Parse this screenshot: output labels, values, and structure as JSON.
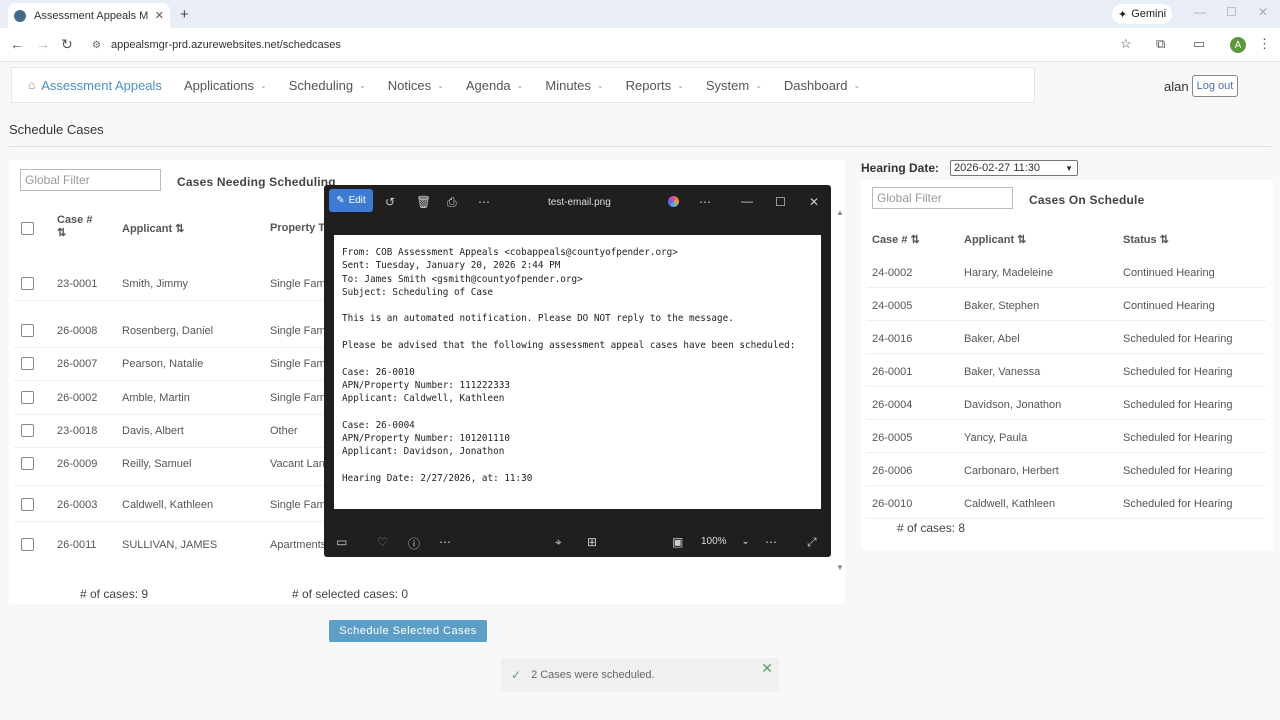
{
  "browser": {
    "tab_title": "Assessment Appeals Managem",
    "new_tab": "+",
    "gemini_label": "Gemini",
    "url": "appealsmgr-prd.azurewebsites.net/schedcases",
    "avatar_letter": "A"
  },
  "nav": {
    "brand": "Assessment Appeals",
    "menus": [
      "Applications",
      "Scheduling",
      "Notices",
      "Agenda",
      "Minutes",
      "Reports",
      "System",
      "Dashboard"
    ],
    "user": "alan",
    "logout": "Log out"
  },
  "page_title": "Schedule Cases",
  "left": {
    "filter_placeholder": "Global Filter",
    "title": "Cases Needing Scheduling",
    "columns": [
      "Case #",
      "Applicant",
      "Property T"
    ],
    "rows": [
      {
        "case": "23-0001",
        "applicant": "Smith, Jimmy",
        "property": "Single Fam"
      },
      {
        "case": "26-0008",
        "applicant": "Rosenberg, Daniel",
        "property": "Single Fam"
      },
      {
        "case": "26-0007",
        "applicant": "Pearson, Natalie",
        "property": "Single Fam"
      },
      {
        "case": "26-0002",
        "applicant": "Amble, Martin",
        "property": "Single Fam"
      },
      {
        "case": "23-0018",
        "applicant": "Davis, Albert",
        "property": "Other"
      },
      {
        "case": "26-0009",
        "applicant": "Reilly, Samuel",
        "property": "Vacant Lan"
      },
      {
        "case": "26-0003",
        "applicant": "Caldwell, Kathleen",
        "property": "Single Fam"
      },
      {
        "case": "26-0011",
        "applicant": "SULLIVAN, JAMES",
        "property": "Apartments"
      }
    ],
    "count_label": "# of cases:",
    "count": "9",
    "selected_label": "# of selected cases:",
    "selected": "0",
    "schedule_button": "Schedule Selected Cases"
  },
  "toast": {
    "message": "2 Cases were scheduled."
  },
  "right": {
    "hearing_label": "Hearing Date:",
    "hearing_value": "2026-02-27 11:30",
    "filter_placeholder": "Global Filter",
    "title": "Cases On Schedule",
    "columns": [
      "Case #",
      "Applicant",
      "Status"
    ],
    "rows": [
      {
        "case": "24-0002",
        "applicant": "Harary, Madeleine",
        "status": "Continued Hearing"
      },
      {
        "case": "24-0005",
        "applicant": "Baker, Stephen",
        "status": "Continued Hearing"
      },
      {
        "case": "24-0016",
        "applicant": "Baker, Abel",
        "status": "Scheduled for Hearing"
      },
      {
        "case": "26-0001",
        "applicant": "Baker, Vanessa",
        "status": "Scheduled for Hearing"
      },
      {
        "case": "26-0004",
        "applicant": "Davidson, Jonathon",
        "status": "Scheduled for Hearing"
      },
      {
        "case": "26-0005",
        "applicant": "Yancy, Paula",
        "status": "Scheduled for Hearing"
      },
      {
        "case": "26-0006",
        "applicant": "Carbonaro, Herbert",
        "status": "Scheduled for Hearing"
      },
      {
        "case": "26-0010",
        "applicant": "Caldwell, Kathleen",
        "status": "Scheduled for Hearing"
      }
    ],
    "count_label": "# of cases:",
    "count": "8"
  },
  "viewer": {
    "edit_label": "Edit",
    "filename": "test-email.png",
    "zoom": "100%",
    "email_lines": [
      "From: COB Assessment Appeals <cobappeals@countyofpender.org>",
      "Sent: Tuesday, January 20, 2026 2:44 PM",
      "To: James Smith <gsmith@countyofpender.org>",
      "Subject: Scheduling of Case",
      "",
      "This is an automated notification. Please DO NOT reply to the message.",
      "",
      "Please be advised that the following assessment appeal cases have been scheduled:",
      "",
      "Case: 26-0010",
      "APN/Property Number: 111222333",
      "Applicant: Caldwell, Kathleen",
      "",
      "Case: 26-0004",
      "APN/Property Number: 101201110",
      "Applicant: Davidson, Jonathon",
      "",
      "Hearing Date: 2/27/2026, at: 11:30"
    ]
  }
}
